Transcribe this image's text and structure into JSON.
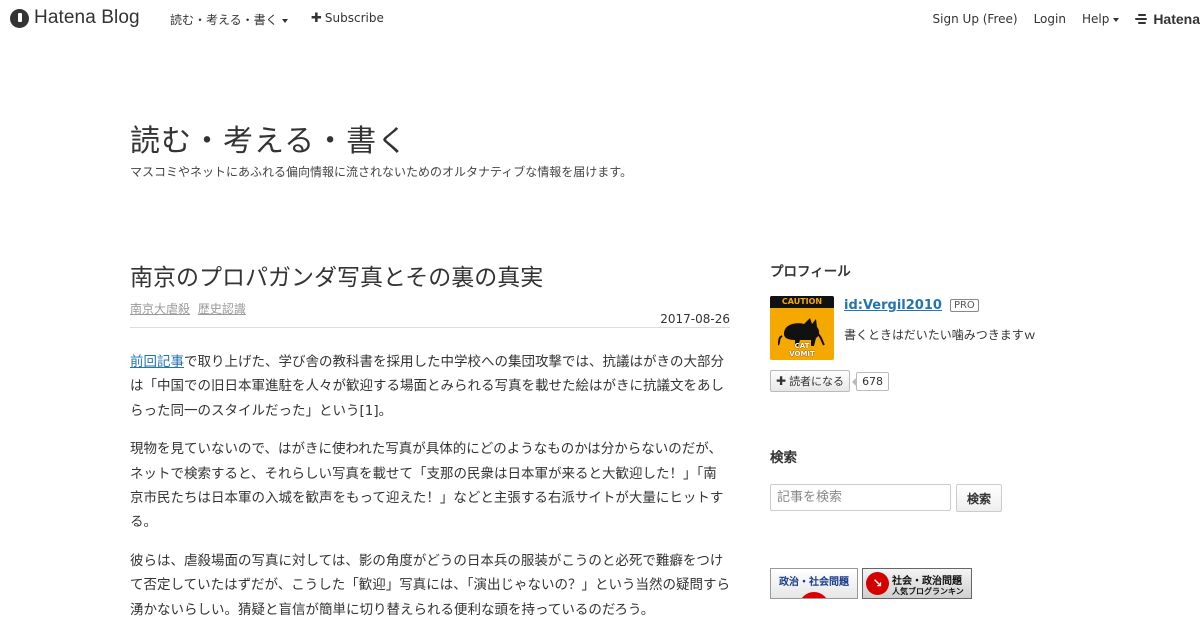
{
  "topbar": {
    "logo_text": "Hatena Blog",
    "blog_menu_label": "読む・考える・書く",
    "subscribe_label": "Subscribe",
    "signup_label": "Sign Up (Free)",
    "login_label": "Login",
    "help_label": "Help",
    "hatena_label": "Hatena"
  },
  "blog": {
    "title": "読む・考える・書く",
    "description": "マスコミやネットにあふれる偏向情報に流されないためのオルタナティブな情報を届けます。"
  },
  "entry": {
    "title": "南京のプロパガンダ写真とその裏の真実",
    "categories": [
      "南京大虐殺",
      "歴史認識"
    ],
    "date": "2017-08-26",
    "p1_link": "前回記事",
    "p1_rest": "で取り上げた、学び舎の教科書を採用した中学校への集団攻撃では、抗議はがきの大部分は「中国での旧日本軍進駐を人々が歓迎する場面とみられる写真を載せた絵はがきに抗議文をあしらった同一のスタイルだった」という[1]。",
    "p2": "現物を見ていないので、はがきに使われた写真が具体的にどのようなものかは分からないのだが、ネットで検索すると、それらしい写真を載せて「支那の民衆は日本軍が来ると大歓迎した！」「南京市民たちは日本軍の入城を歓声をもって迎えた！」などと主張する右派サイトが大量にヒットする。",
    "p3": "彼らは、虐殺場面の写真に対しては、影の角度がどうの日本兵の服装がこうのと必死で難癖をつけて否定していたはずだが、こうした「歓迎」写真には、「演出じゃないの？」という当然の疑問すら湧かないらしい。猜疑と盲信が簡単に切り替えられる便利な頭を持っているのだろう。"
  },
  "sidebar": {
    "profile_heading": "プロフィール",
    "avatar_caption_top": "CAUTION",
    "avatar_caption_bottom": "CAT VOMIT",
    "profile_id": "id:Vergil2010",
    "pro_badge": "PRO",
    "profile_text": "書くときはだいたい噛みつきますｗ",
    "reader_button": "読者になる",
    "reader_count": "678",
    "search_heading": "検索",
    "search_placeholder": "記事を検索",
    "search_button": "検索",
    "banner1_text": "政治・社会問題",
    "banner2_top": "社会・政治問題",
    "banner2_bottom": "人気ブログランキング"
  },
  "colors": {
    "link": "#2474b2",
    "text": "#333333",
    "caution_yellow": "#f5a800",
    "banner_red": "#d40000"
  }
}
